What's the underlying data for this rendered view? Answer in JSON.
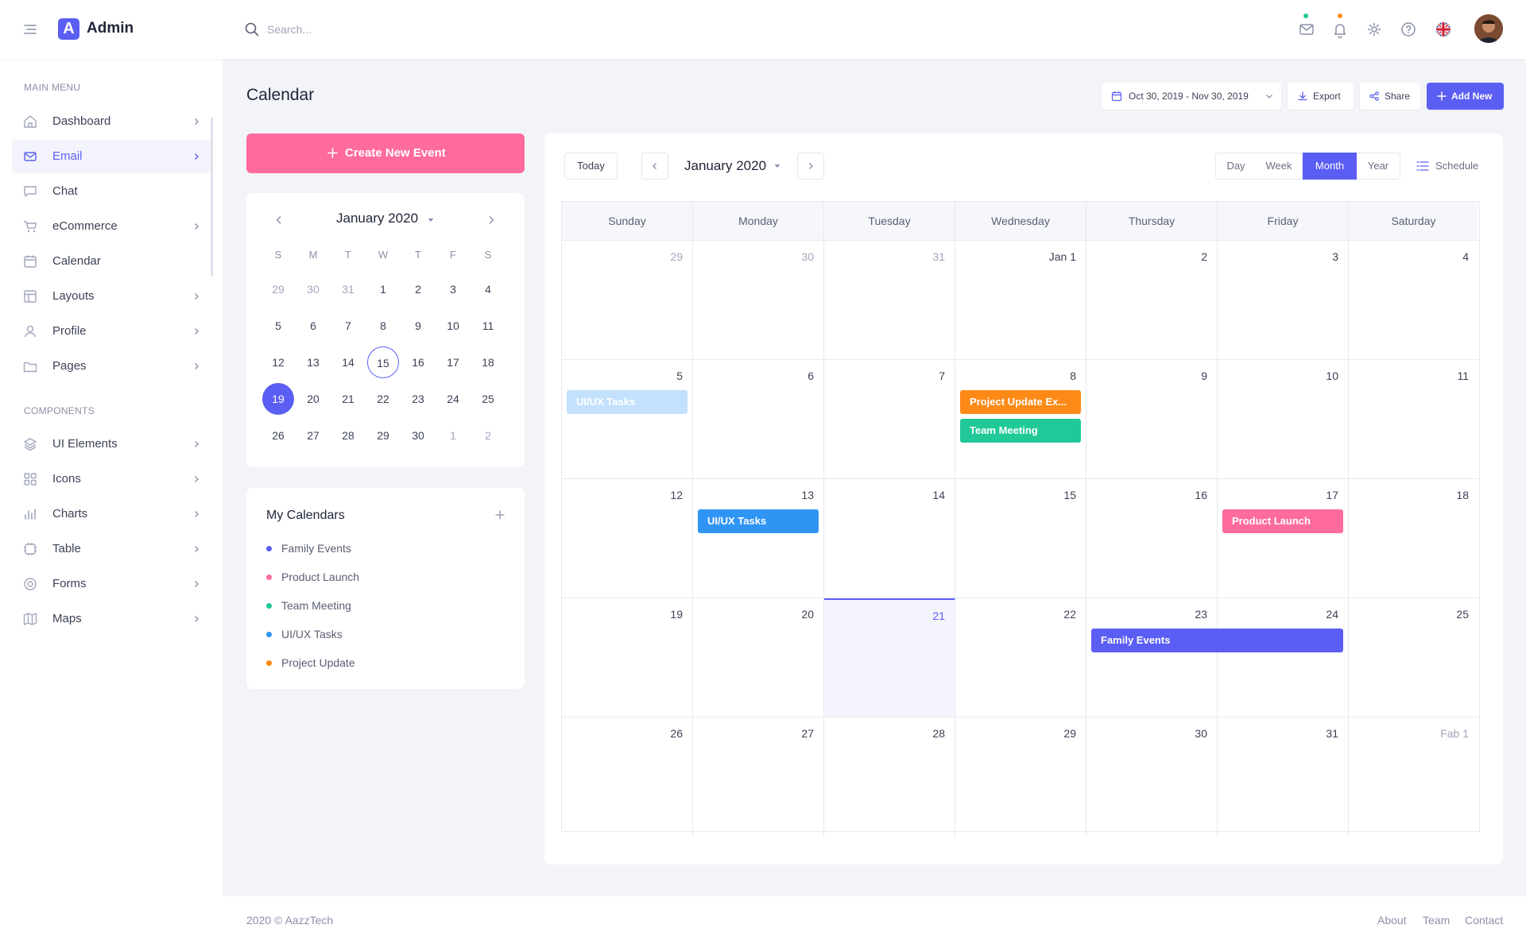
{
  "app": {
    "name": "Admin",
    "logo_letter": "A"
  },
  "search": {
    "placeholder": "Search..."
  },
  "header_icons": [
    "mail-icon",
    "bell-icon",
    "gear-icon",
    "help-icon",
    "uk-flag-icon"
  ],
  "sidebar": {
    "main_heading": "MAIN MENU",
    "components_heading": "COMPONENTS",
    "main_items": [
      {
        "label": "Dashboard",
        "icon": "home-icon"
      },
      {
        "label": "Email",
        "icon": "mail-icon",
        "active": true
      },
      {
        "label": "Chat",
        "icon": "chat-icon"
      },
      {
        "label": "eCommerce",
        "icon": "cart-icon"
      },
      {
        "label": "Calendar",
        "icon": "calendar-icon"
      },
      {
        "label": "Layouts",
        "icon": "layout-icon"
      },
      {
        "label": "Profile",
        "icon": "user-icon"
      },
      {
        "label": "Pages",
        "icon": "folder-icon"
      }
    ],
    "component_items": [
      {
        "label": "UI Elements",
        "icon": "layers-icon"
      },
      {
        "label": "Icons",
        "icon": "grid-icon"
      },
      {
        "label": "Charts",
        "icon": "bar-chart-icon"
      },
      {
        "label": "Table",
        "icon": "table-icon"
      },
      {
        "label": "Forms",
        "icon": "target-icon"
      },
      {
        "label": "Maps",
        "icon": "map-icon"
      }
    ]
  },
  "page": {
    "title": "Calendar"
  },
  "toolbar": {
    "date_range": "Oct 30, 2019 - Nov 30, 2019",
    "export": "Export",
    "share": "Share",
    "add_new": "Add New"
  },
  "create_event": {
    "label": "Create New Event"
  },
  "mini_calendar": {
    "month": "January 2020",
    "dow": [
      "S",
      "M",
      "T",
      "W",
      "T",
      "F",
      "S"
    ],
    "weeks": [
      [
        "29",
        "30",
        "31",
        "1",
        "2",
        "3",
        "4"
      ],
      [
        "5",
        "6",
        "7",
        "8",
        "9",
        "10",
        "11"
      ],
      [
        "12",
        "13",
        "14",
        "15",
        "16",
        "17",
        "18"
      ],
      [
        "19",
        "20",
        "21",
        "22",
        "23",
        "24",
        "25"
      ],
      [
        "26",
        "27",
        "28",
        "29",
        "30",
        "1",
        "2"
      ]
    ],
    "today": "15",
    "selected": "19"
  },
  "my_calendars": {
    "title": "My Calendars",
    "items": [
      {
        "label": "Family Events",
        "color": "#5b5ef3"
      },
      {
        "label": "Product Launch",
        "color": "#ff6b9d"
      },
      {
        "label": "Team Meeting",
        "color": "#20c997"
      },
      {
        "label": "UI/UX Tasks",
        "color": "#2f95f5"
      },
      {
        "label": "Project Update",
        "color": "#fd8a17"
      }
    ]
  },
  "main_calendar": {
    "today_label": "Today",
    "month": "January 2020",
    "views": [
      "Day",
      "Week",
      "Month",
      "Year"
    ],
    "active_view": "Month",
    "schedule_label": "Schedule",
    "dow": [
      "Sunday",
      "Monday",
      "Tuesday",
      "Wednesday",
      "Thursday",
      "Friday",
      "Saturday"
    ],
    "weeks": [
      [
        "29",
        "30",
        "31",
        "Jan 1",
        "2",
        "3",
        "4"
      ],
      [
        "5",
        "6",
        "7",
        "8",
        "9",
        "10",
        "11"
      ],
      [
        "12",
        "13",
        "14",
        "15",
        "16",
        "17",
        "18"
      ],
      [
        "19",
        "20",
        "21",
        "22",
        "23",
        "24",
        "25"
      ],
      [
        "26",
        "27",
        "28",
        "29",
        "30",
        "31",
        "Fab 1"
      ]
    ],
    "current_day": "21",
    "events": [
      {
        "title": "UI/UX Tasks",
        "week": 1,
        "day": 0,
        "span": 1,
        "slot": 0,
        "color": "#c3e1fd",
        "text_color": "#ffffff"
      },
      {
        "title": "Project Update Ex...",
        "week": 1,
        "day": 3,
        "span": 1,
        "slot": 0,
        "color": "#fd8a17",
        "text_color": "#ffffff"
      },
      {
        "title": "Team Meeting",
        "week": 1,
        "day": 3,
        "span": 1,
        "slot": 1,
        "color": "#20c997",
        "text_color": "#ffffff"
      },
      {
        "title": "UI/UX Tasks",
        "week": 2,
        "day": 1,
        "span": 1,
        "slot": 0,
        "color": "#2f95f5",
        "text_color": "#ffffff"
      },
      {
        "title": "Product Launch",
        "week": 2,
        "day": 5,
        "span": 1,
        "slot": 0,
        "color": "#ff6b9d",
        "text_color": "#ffffff"
      },
      {
        "title": "Family Events",
        "week": 3,
        "day": 4,
        "span": 2,
        "slot": 0,
        "color": "#5b5ef3",
        "text_color": "#ffffff"
      }
    ]
  },
  "footer": {
    "copyright": "2020 © AazzTech",
    "links": [
      "About",
      "Team",
      "Contact"
    ]
  },
  "colors": {
    "accent": "#5b5ef3",
    "pink": "#ff6b9d"
  }
}
